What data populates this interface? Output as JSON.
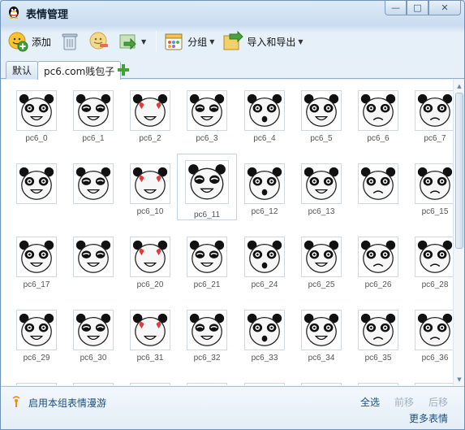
{
  "window": {
    "title": "表情管理",
    "minimize_glyph": "—",
    "maximize_glyph": "□",
    "close_glyph": "✕"
  },
  "toolbar": {
    "add_label": "添加",
    "group_label": "分组",
    "import_export_label": "导入和导出",
    "caret": "▼"
  },
  "tabs": [
    {
      "label": "默认"
    },
    {
      "label": "pc6.com贱包子"
    }
  ],
  "emoticons": [
    {
      "label": "pc6_0"
    },
    {
      "label": "pc6_1"
    },
    {
      "label": "pc6_2"
    },
    {
      "label": "pc6_3"
    },
    {
      "label": "pc6_4"
    },
    {
      "label": "pc6_5"
    },
    {
      "label": "pc6_6"
    },
    {
      "label": "pc6_7"
    },
    {
      "label": ""
    },
    {
      "label": ""
    },
    {
      "label": "pc6_10"
    },
    {
      "label": "pc6_11"
    },
    {
      "label": "pc6_12"
    },
    {
      "label": "pc6_13"
    },
    {
      "label": ""
    },
    {
      "label": "pc6_15"
    },
    {
      "label": "pc6_17"
    },
    {
      "label": ""
    },
    {
      "label": "pc6_20"
    },
    {
      "label": "pc6_21"
    },
    {
      "label": "pc6_24"
    },
    {
      "label": "pc6_25"
    },
    {
      "label": "pc6_26"
    },
    {
      "label": "pc6_28"
    },
    {
      "label": "pc6_29"
    },
    {
      "label": "pc6_30"
    },
    {
      "label": "pc6_31"
    },
    {
      "label": "pc6_32"
    },
    {
      "label": "pc6_33"
    },
    {
      "label": "pc6_34"
    },
    {
      "label": "pc6_35"
    },
    {
      "label": "pc6_36"
    }
  ],
  "footer": {
    "roam_label": "启用本组表情漫游",
    "select_all": "全选",
    "move_forward": "前移",
    "move_back": "后移",
    "more": "更多表情"
  },
  "colors": {
    "link": "#1a4e85",
    "disabled_link": "#a1b2c3",
    "accent_green": "#3fa33a"
  }
}
